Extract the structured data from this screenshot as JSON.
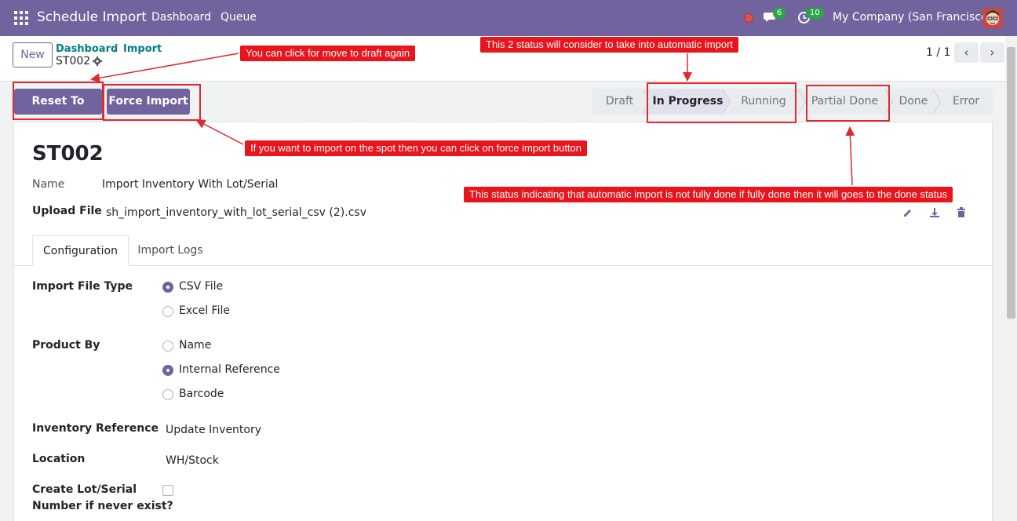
{
  "navbar": {
    "app_name": "Schedule Import",
    "menu": [
      "Dashboard",
      "Queue"
    ],
    "chat_count": "6",
    "activity_count": "10",
    "company": "My Company (San Francisco)"
  },
  "control": {
    "new_label": "New",
    "breadcrumb": [
      "Dashboard",
      "Import"
    ],
    "breadcrumb_sep": "/",
    "current": "ST002",
    "pager": "1 / 1",
    "prev_glyph": "‹",
    "next_glyph": "›"
  },
  "actions": {
    "reset_label": "Reset To Draft",
    "force_label": "Force Import"
  },
  "stages": [
    "Draft",
    "In Progress",
    "Running",
    "Partial Done",
    "Done",
    "Error"
  ],
  "active_stage": "In Progress",
  "record": {
    "title": "ST002",
    "name_label": "Name",
    "name_value": "Import Inventory With Lot/Serial",
    "upload_label": "Upload File",
    "upload_value": "sh_import_inventory_with_lot_serial_csv (2).csv"
  },
  "tabs": [
    "Configuration",
    "Import Logs"
  ],
  "config": {
    "file_type_label": "Import File Type",
    "file_type_options": [
      "CSV File",
      "Excel File"
    ],
    "file_type_selected": "CSV File",
    "product_by_label": "Product By",
    "product_by_options": [
      "Name",
      "Internal Reference",
      "Barcode"
    ],
    "product_by_selected": "Internal Reference",
    "inventory_ref_label": "Inventory Reference",
    "inventory_ref_value": "Update Inventory",
    "location_label": "Location",
    "location_value": "WH/Stock",
    "lot_label_1": "Create Lot/Serial",
    "lot_label_2": "Number if never exist?"
  },
  "annotations": {
    "draft_tip": "You can click for move to draft again",
    "status_tip": "This 2 status will consider to take into automatic import",
    "force_tip": "If you want to import on the spot then you can click on force import button",
    "partial_tip": "This status indicating that automatic import is not fully done if fully done then it will goes to the done status"
  },
  "colors": {
    "brand": "#71639e",
    "annotation": "#e9141c"
  }
}
